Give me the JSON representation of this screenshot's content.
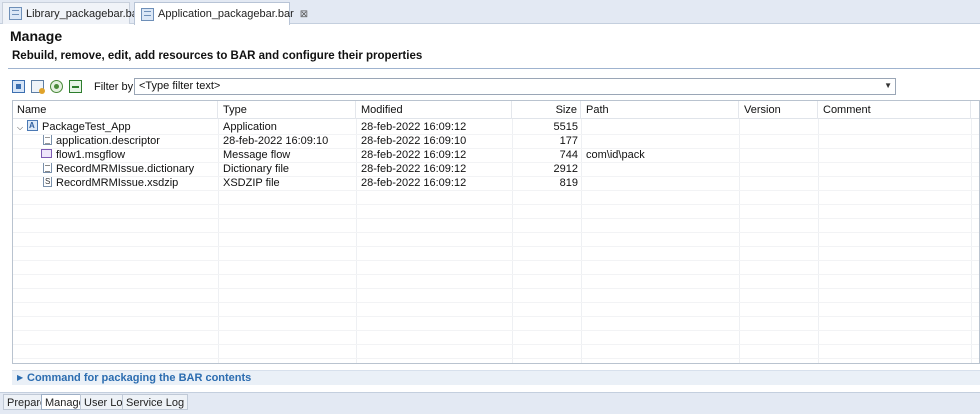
{
  "editor_tabs": [
    {
      "label": "Library_packagebar.bar",
      "active": false
    },
    {
      "label": "Application_packagebar.bar",
      "active": true,
      "close": "⊠"
    }
  ],
  "page": {
    "title": "Manage",
    "subtitle": "Rebuild, remove, edit, add resources to BAR and configure their properties"
  },
  "toolbar": {
    "buttons": [
      "grid-icon",
      "deploy-icon",
      "refresh-icon",
      "add-icon"
    ]
  },
  "filter": {
    "label": "Filter by:",
    "value": "<Type filter text>"
  },
  "table": {
    "columns": [
      "Name",
      "Type",
      "Modified",
      "Size",
      "Path",
      "Version",
      "Comment"
    ],
    "rows": [
      {
        "name": "PackageTest_App",
        "type": "Application",
        "modified": "28-feb-2022  16:09:12",
        "size": "5515",
        "path": "",
        "version": "",
        "comment": "",
        "icon": "app",
        "expanded": true,
        "level": 0
      },
      {
        "name": "application.descriptor",
        "type": "28-feb-2022  16:09:10",
        "modified": "28-feb-2022  16:09:10",
        "size": "177",
        "path": "",
        "version": "",
        "comment": "",
        "icon": "desc",
        "level": 1
      },
      {
        "name": "flow1.msgflow",
        "type": "Message flow",
        "modified": "28-feb-2022  16:09:12",
        "size": "744",
        "path": "com\\id\\pack",
        "version": "",
        "comment": "",
        "icon": "flow",
        "level": 1
      },
      {
        "name": "RecordMRMIssue.dictionary",
        "type": "Dictionary file",
        "modified": "28-feb-2022  16:09:12",
        "size": "2912",
        "path": "",
        "version": "",
        "comment": "",
        "icon": "dict",
        "level": 1
      },
      {
        "name": "RecordMRMIssue.xsdzip",
        "type": "XSDZIP file",
        "modified": "28-feb-2022  16:09:12",
        "size": "819",
        "path": "",
        "version": "",
        "comment": "",
        "icon": "xsd",
        "level": 1
      }
    ]
  },
  "command_section": {
    "label": "Command for packaging the BAR contents"
  },
  "bottom_tabs": [
    {
      "label": "Prepare",
      "active": false
    },
    {
      "label": "Manage",
      "active": true
    },
    {
      "label": "User Log",
      "active": false
    },
    {
      "label": "Service Log",
      "active": false
    }
  ],
  "colors": {
    "accent": "#2b6cb0",
    "tab_bar": "#e3e9f3"
  }
}
